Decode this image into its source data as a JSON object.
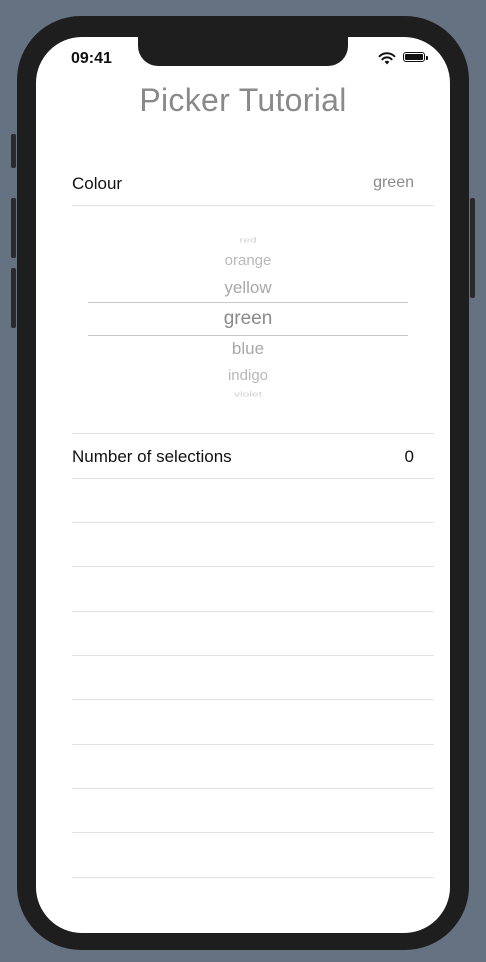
{
  "status": {
    "time": "09:41"
  },
  "title": "Picker Tutorial",
  "colour_row": {
    "label": "Colour",
    "value": "green"
  },
  "picker": {
    "options": [
      "red",
      "orange",
      "yellow",
      "green",
      "blue",
      "indigo",
      "violet"
    ],
    "selected": "green"
  },
  "selections_row": {
    "label": "Number of selections",
    "value": "0"
  },
  "colors": {
    "background": "#647281",
    "title": "#8a8a8a",
    "separator": "#e2e2e4"
  }
}
